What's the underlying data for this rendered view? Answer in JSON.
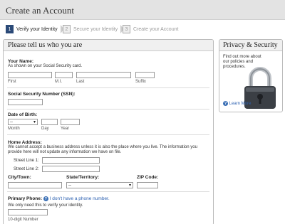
{
  "header": {
    "title": "Create an Account"
  },
  "steps": [
    {
      "number": "1",
      "label": "Verify your Identity"
    },
    {
      "number": "2",
      "label": "Secure your Identity"
    },
    {
      "number": "3",
      "label": "Create your Account"
    }
  ],
  "form": {
    "title": "Please tell us who you are",
    "name": {
      "label": "Your Name:",
      "note": "As shown on your Social Security card.",
      "first": "First",
      "mi": "M.I.",
      "last": "Last",
      "suffix": "Suffix"
    },
    "ssn": {
      "label": "Social Security Number (SSN):"
    },
    "dob": {
      "label": "Date of Birth:",
      "month_value": "--",
      "month": "Month",
      "day": "Day",
      "year": "Year"
    },
    "address": {
      "label": "Home Address:",
      "note": "We cannot accept a business address unless it is also the place where you live. The information you provide here will not update any information we have on file.",
      "street1": "Street Line 1:",
      "street2": "Street Line 2:",
      "city": "City/Town:",
      "state": "State/Territory:",
      "state_value": "--",
      "zip": "ZIP Code:"
    },
    "phone": {
      "label": "Primary Phone:",
      "help": "?",
      "no_phone_link": "I don't have a phone number.",
      "note": "We only need this to verify your identity.",
      "sub": "10-digit Number"
    }
  },
  "sidebar": {
    "title": "Privacy & Security",
    "text": "Find out more about our policies and procedures.",
    "learn_more": "Learn More",
    "help": "?"
  },
  "colors": {
    "step_active": "#2b4a78",
    "link": "#2a5fb0",
    "header_bg": "#e3e3e3"
  }
}
